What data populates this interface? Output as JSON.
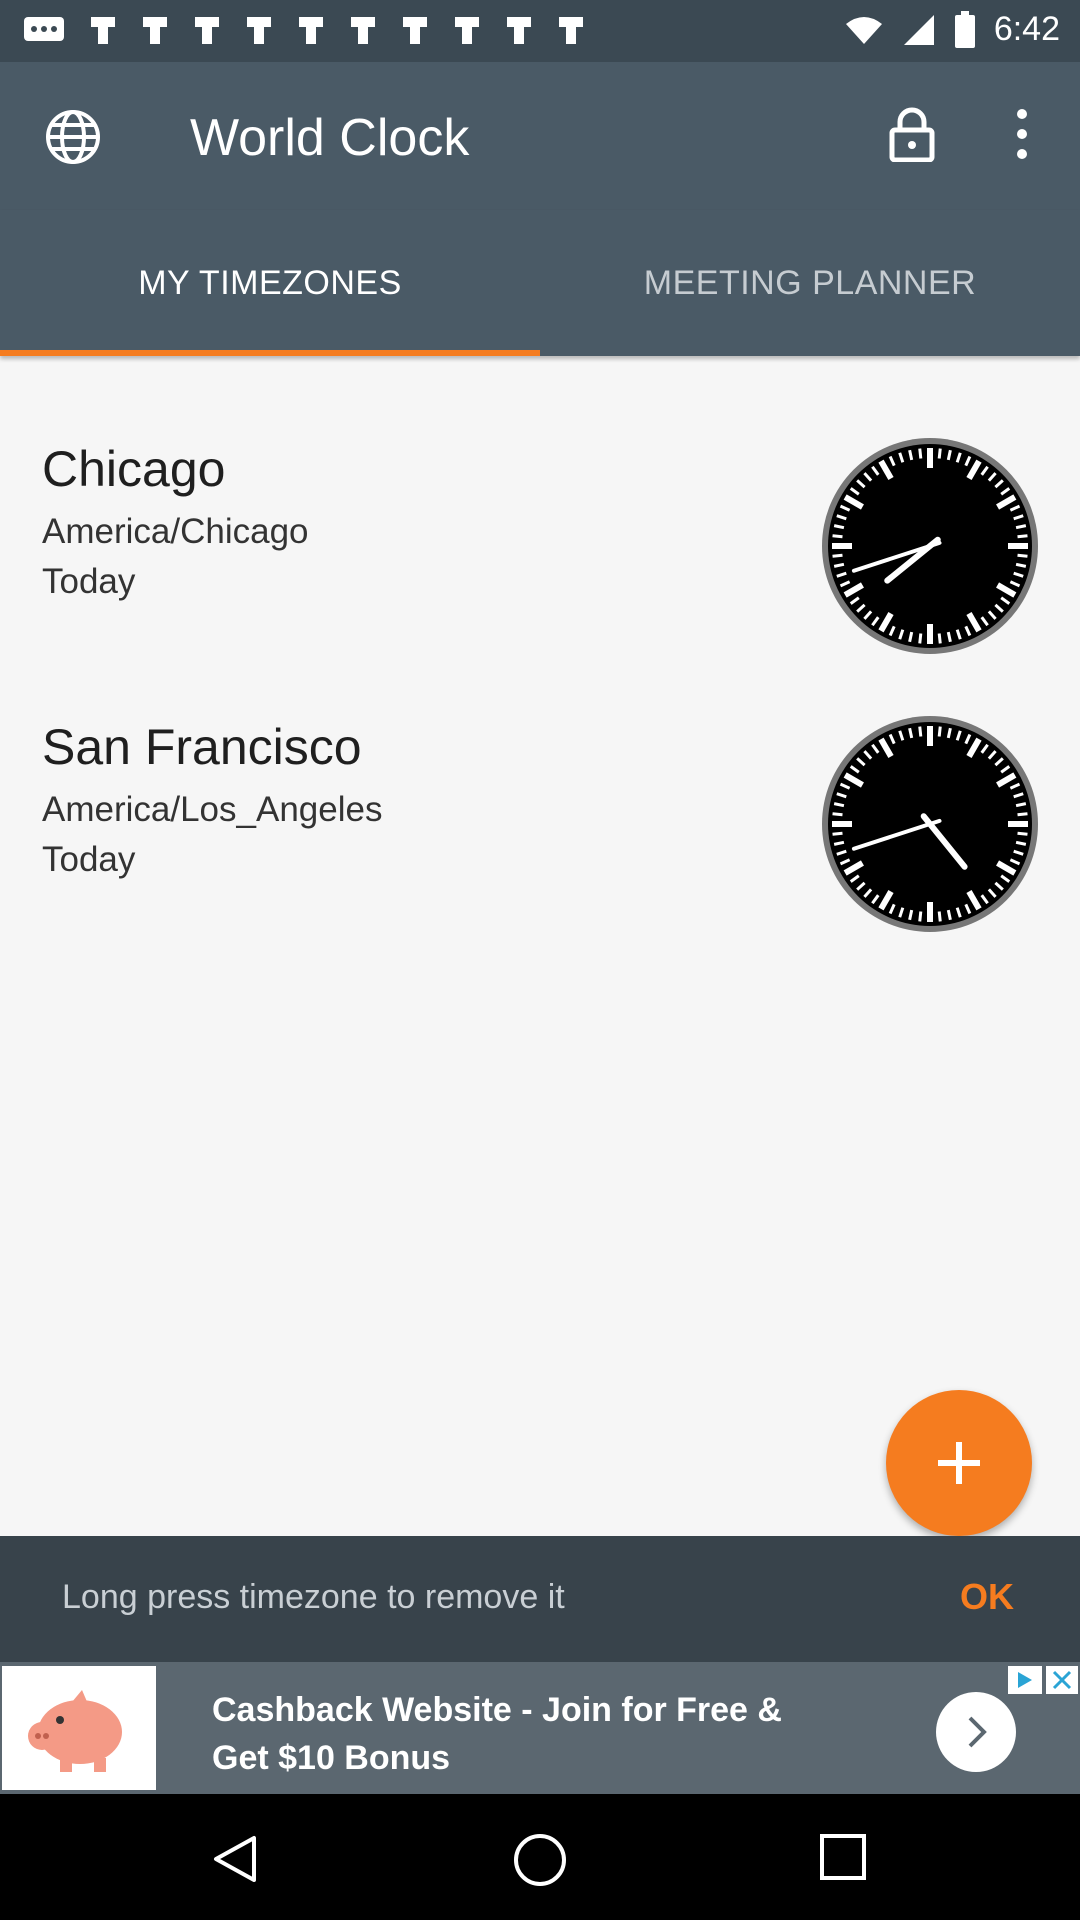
{
  "status_bar": {
    "time": "6:42",
    "icons": [
      "message-icon",
      "notification-icon",
      "notification-icon",
      "notification-icon",
      "notification-icon",
      "notification-icon",
      "notification-icon",
      "notification-icon",
      "notification-icon",
      "notification-icon",
      "notification-icon",
      "wifi-icon",
      "signal-icon",
      "battery-icon"
    ]
  },
  "app_bar": {
    "title": "World Clock",
    "icons": [
      "globe-icon",
      "lock-icon",
      "more-vert-icon"
    ]
  },
  "tabs": [
    {
      "label": "MY TIMEZONES",
      "active": true
    },
    {
      "label": "MEETING PLANNER",
      "active": false
    }
  ],
  "timezones": [
    {
      "city": "Chicago",
      "zone": "America/Chicago",
      "day": "Today",
      "hour": 7,
      "minute": 42
    },
    {
      "city": "San Francisco",
      "zone": "America/Los_Angeles",
      "day": "Today",
      "hour": 4,
      "minute": 42
    }
  ],
  "fab": {
    "icon": "add-icon"
  },
  "snackbar": {
    "message": "Long press timezone to remove it",
    "action": "OK"
  },
  "ad": {
    "line1": "Cashback Website - Join for Free &",
    "line2": "Get $10 Bonus",
    "icons": [
      "piggy-bank-icon",
      "adchoices-icon",
      "close-icon",
      "chevron-right-icon"
    ]
  },
  "nav_bar": {
    "icons": [
      "back-icon",
      "home-icon",
      "recents-icon"
    ]
  },
  "colors": {
    "accent": "#f57c1f",
    "app_bar": "#4a5a66",
    "status_bar": "#3b4953",
    "snackbar": "#38434b"
  }
}
